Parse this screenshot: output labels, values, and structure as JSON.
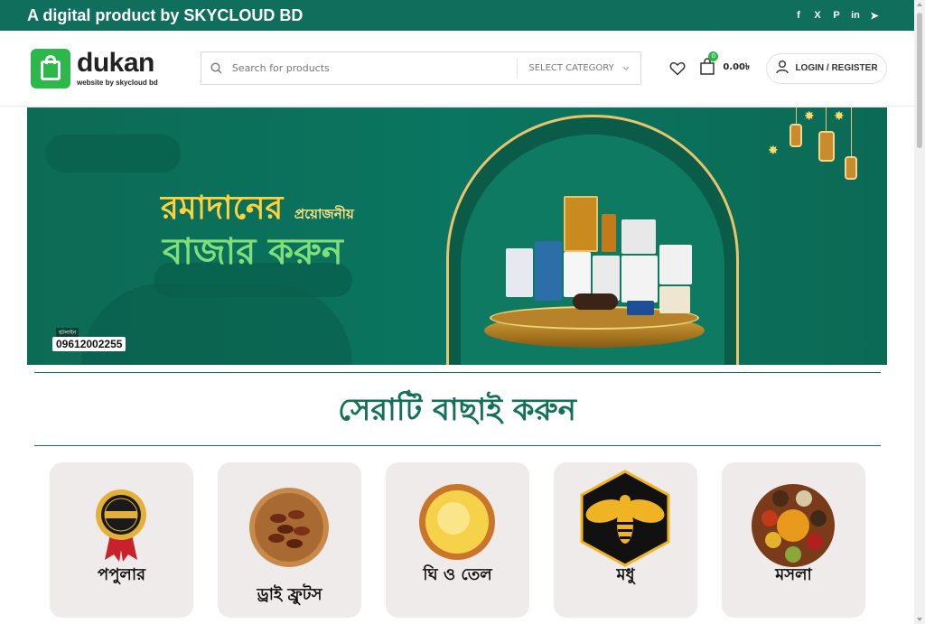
{
  "topbar": {
    "tagline": "A digital product by SKYCLOUD BD",
    "social": [
      {
        "icon": "facebook-icon",
        "glyph": "f"
      },
      {
        "icon": "x-icon",
        "glyph": "X"
      },
      {
        "icon": "pinterest-icon",
        "glyph": "P"
      },
      {
        "icon": "linkedin-icon",
        "glyph": "in"
      },
      {
        "icon": "telegram-icon",
        "glyph": "➤"
      }
    ]
  },
  "header": {
    "logo_name": "dukan",
    "logo_sub": "website by skycloud bd",
    "search_placeholder": "Search for products",
    "category_label": "SELECT CATEGORY",
    "cart_count": "0",
    "cart_total": "0.00৳",
    "login_label": "LOGIN / REGISTER"
  },
  "banner": {
    "headline1": "রমাদানের",
    "headline1_small": "প্রয়োজনীয়",
    "headline2": "বাজার করুন",
    "phone_label": "হটলাইন",
    "phone": "09612002255"
  },
  "section": {
    "title": "সেরাটি বাছাই করুন"
  },
  "categories": [
    {
      "label": "পপুলার",
      "icon": "best-seller-badge-icon"
    },
    {
      "label": "ড্রাই ফ্রুটস",
      "icon": "dates-bowl-icon"
    },
    {
      "label": "ঘি ও তেল",
      "icon": "ghee-bowl-icon"
    },
    {
      "label": "মধু",
      "icon": "bee-icon"
    },
    {
      "label": "মসলা",
      "icon": "spices-plate-icon"
    }
  ],
  "colors": {
    "brand": "#0f6f5c",
    "accent_green": "#2eb84b",
    "card_bg": "#efebea"
  }
}
